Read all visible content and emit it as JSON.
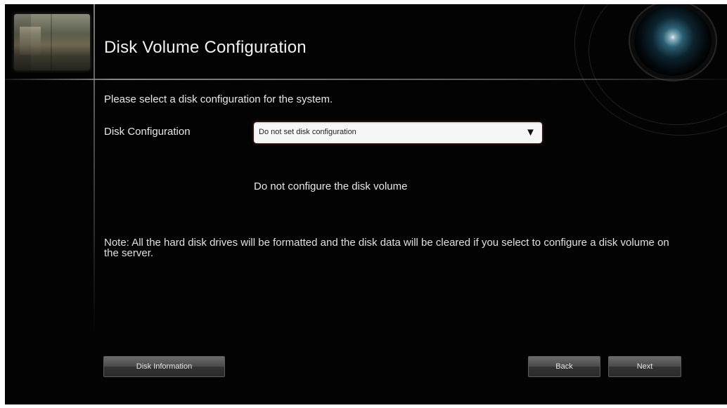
{
  "header": {
    "title": "Disk Volume Configuration"
  },
  "form": {
    "prompt": "Please select a disk configuration for the system.",
    "disk_config_label": "Disk Configuration",
    "disk_config_selected": "Do not set disk configuration",
    "description": "Do not configure the disk volume",
    "note": "Note: All the hard disk drives will be formatted and the disk data will be cleared if you select to configure a disk volume on the server."
  },
  "buttons": {
    "disk_information": "Disk Information",
    "back": "Back",
    "next": "Next"
  },
  "icons": {
    "dropdown_arrow": "▼",
    "dropdown_arrow_name": "chevron-down-icon",
    "header_image": "camera-lens-icon"
  },
  "colors": {
    "background": "#030303",
    "text": "#e8e8e8",
    "select_background": "#f7f7f7"
  }
}
